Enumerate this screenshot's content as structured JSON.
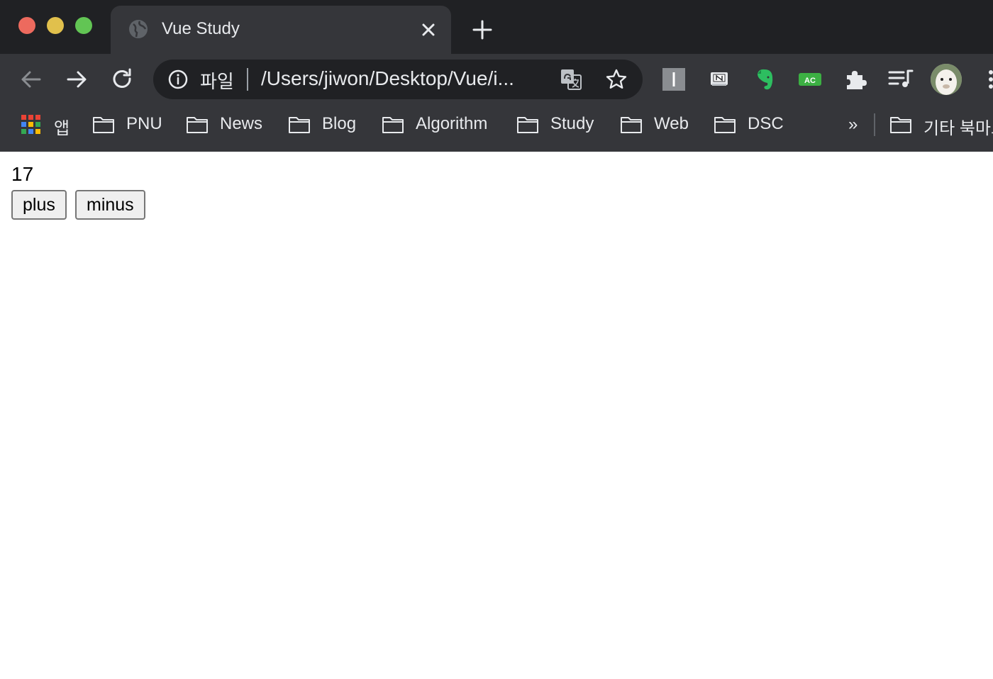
{
  "window": {
    "tab_title": "Vue Study"
  },
  "omnibox": {
    "scheme_label": "파일",
    "url": "/Users/jiwon/Desktop/Vue/i..."
  },
  "bookmarks": {
    "apps_label": "앱",
    "items": [
      {
        "label": "PNU"
      },
      {
        "label": "News"
      },
      {
        "label": "Blog"
      },
      {
        "label": "Algorithm"
      },
      {
        "label": "Study"
      },
      {
        "label": "Web"
      },
      {
        "label": "DSC"
      }
    ],
    "more_label": "»",
    "other_label": "기타 북마크"
  },
  "extensions": {
    "ac_badge": "AC",
    "n_badge": "N"
  },
  "page": {
    "counter": "17",
    "plus_label": "plus",
    "minus_label": "minus"
  },
  "colors": {
    "tabstrip": "#202124",
    "toolbar": "#35363a",
    "text": "#e8eaed",
    "evernote_green": "#2dbe60",
    "ac_green": "#3cb043"
  }
}
